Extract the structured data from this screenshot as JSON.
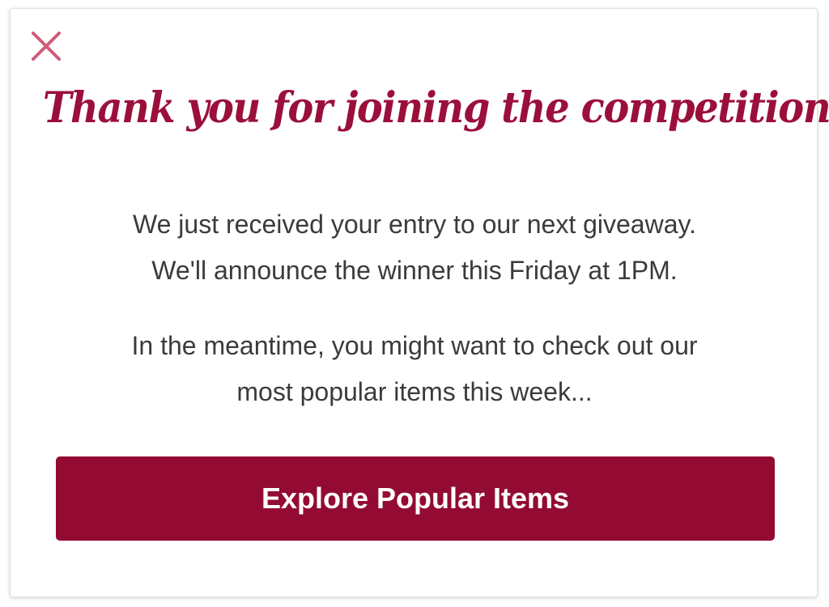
{
  "modal": {
    "close_icon": "close-icon",
    "accent_color": "#9b0f3b",
    "title": "Thank you for joining the competition!",
    "paragraph1": {
      "line1": "We just received your entry to our next giveaway.",
      "line2": "We'll announce the winner this Friday at 1PM."
    },
    "paragraph2": {
      "line1": "In the meantime, you might want to check out our",
      "line2": "most popular items this week..."
    },
    "cta_label": "Explore Popular Items",
    "cta_color": "#930b33"
  }
}
